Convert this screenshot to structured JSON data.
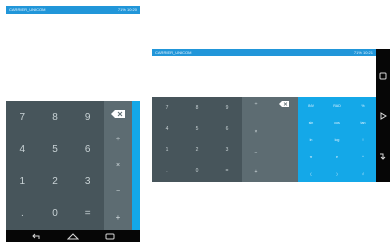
{
  "portrait": {
    "status": {
      "carrier": "CARRIER_UNICOM",
      "right": "71% 10:20"
    },
    "keys": [
      "7",
      "8",
      "9",
      "4",
      "5",
      "6",
      "1",
      "2",
      "3",
      ".",
      "0",
      "="
    ],
    "ops": [
      "÷",
      "×",
      "−",
      "+"
    ]
  },
  "landscape": {
    "status": {
      "carrier": "CARRIER_UNICOM",
      "right": "71% 10:21"
    },
    "keys": [
      "7",
      "8",
      "9",
      "4",
      "5",
      "6",
      "1",
      "2",
      "3",
      ".",
      "0",
      "="
    ],
    "ops": [
      "÷",
      "×",
      "−",
      "+"
    ],
    "adv_keys": [
      "INV",
      "RAD",
      "%",
      "sin",
      "cos",
      "tan",
      "ln",
      "log",
      "!",
      "π",
      "e",
      "^",
      "(",
      ")",
      "√"
    ]
  },
  "colors": {
    "accent": "#2196d9",
    "keypad": "#47555b",
    "op": "#5d6c72",
    "advanced": "#14a8e8"
  },
  "icons": [
    "backspace-icon",
    "back-icon",
    "home-icon",
    "recents-icon"
  ]
}
